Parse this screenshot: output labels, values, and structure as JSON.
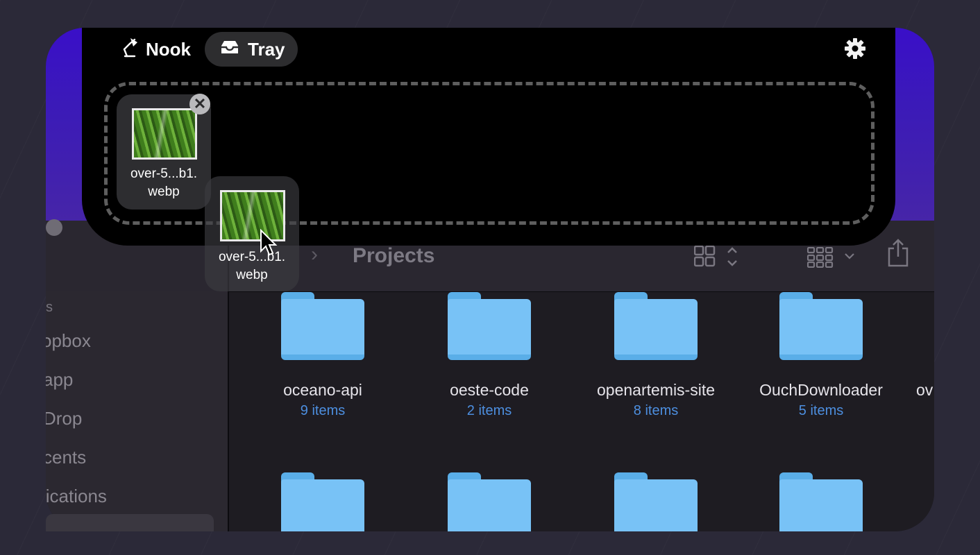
{
  "notch": {
    "tabs": [
      {
        "label": "Nook",
        "icon": "lamp-icon",
        "active": false
      },
      {
        "label": "Tray",
        "icon": "tray-icon",
        "active": true
      }
    ],
    "settings_icon": "gear-icon"
  },
  "tray": {
    "files": [
      {
        "line1": "over-5...b1.",
        "line2": "webp"
      },
      {
        "line1": "over-5...b1.",
        "line2": "webp"
      }
    ]
  },
  "finder": {
    "breadcrumb_title": "Projects",
    "sidebar": {
      "header": "s",
      "items": [
        "opbox",
        "app",
        "Drop",
        "cents",
        "lications"
      ]
    },
    "folders": [
      {
        "name": "oceano-api",
        "count": "9 items"
      },
      {
        "name": "oeste-code",
        "count": "2 items"
      },
      {
        "name": "openartemis-site",
        "count": "8 items"
      },
      {
        "name": "OuchDownloader",
        "count": "5 items"
      },
      {
        "name": "ov",
        "count": ""
      }
    ]
  },
  "colors": {
    "accent_blue": "#4d8fe0",
    "folder_blue": "#78c2f6",
    "notch_black": "#000000",
    "purple": "#3a0fc8"
  }
}
